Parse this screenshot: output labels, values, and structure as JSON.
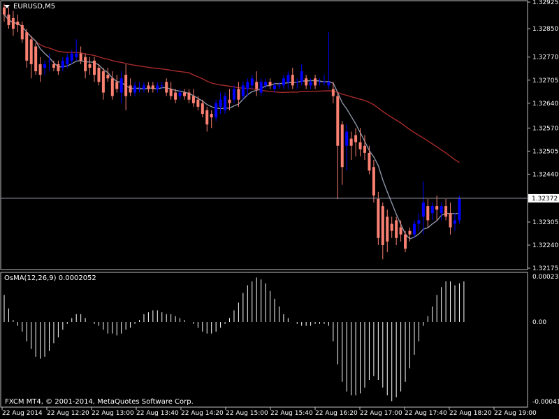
{
  "header": {
    "symbol_label": "EURUSD,M5",
    "indicator_label": "OsMA(12,26,9) 0.0002052",
    "copyright": "FXCM MT4, © 2001-2014, MetaQuotes Software Corp."
  },
  "colors": {
    "background": "#000000",
    "frame": "#c0c0c0",
    "bull": "#0000ff",
    "bear": "#fa8072",
    "ma_fast": "#8c95a6",
    "ma_slow": "#a52a2a",
    "price_line": "#a0a0b4",
    "text": "#ffffff"
  },
  "chart_data": [
    {
      "type": "candlestick",
      "symbol": "EURUSD",
      "timeframe": "M5",
      "ylim": [
        1.32175,
        1.32925
      ],
      "y_ticks": [
        "1.32925",
        "1.32850",
        "1.32770",
        "1.32705",
        "1.32640",
        "1.32570",
        "1.32505",
        "1.32440",
        "1.32305",
        "1.32240",
        "1.32175"
      ],
      "current_price": "1.32372",
      "x_ticks": [
        "22 Aug 2014",
        "22 Aug 12:20",
        "22 Aug 13:00",
        "22 Aug 13:40",
        "22 Aug 14:20",
        "22 Aug 15:00",
        "22 Aug 15:40",
        "22 Aug 16:20",
        "22 Aug 17:00",
        "22 Aug 17:40",
        "22 Aug 18:20",
        "22 Aug 19:00"
      ],
      "candles": [
        [
          1.3291,
          1.3292,
          1.3287,
          1.3289
        ],
        [
          1.3289,
          1.3291,
          1.3285,
          1.3286
        ],
        [
          1.3288,
          1.329,
          1.3283,
          1.3285
        ],
        [
          1.3287,
          1.3289,
          1.3284,
          1.3286
        ],
        [
          1.3286,
          1.3287,
          1.3281,
          1.3282
        ],
        [
          1.3284,
          1.3285,
          1.3274,
          1.3276
        ],
        [
          1.3282,
          1.3283,
          1.3271,
          1.3275
        ],
        [
          1.328,
          1.3281,
          1.3272,
          1.3273
        ],
        [
          1.3275,
          1.3277,
          1.327,
          1.3272
        ],
        [
          1.3274,
          1.3276,
          1.3272,
          1.3275
        ],
        [
          1.3276,
          1.3278,
          1.3273,
          1.3276
        ],
        [
          1.3275,
          1.3276,
          1.3273,
          1.3274
        ],
        [
          1.3275,
          1.3276,
          1.3272,
          1.3273
        ],
        [
          1.3274,
          1.3277,
          1.3273,
          1.3276
        ],
        [
          1.3275,
          1.3278,
          1.3274,
          1.3277
        ],
        [
          1.3276,
          1.3279,
          1.3275,
          1.3278
        ],
        [
          1.3277,
          1.3282,
          1.3276,
          1.3278
        ],
        [
          1.3278,
          1.328,
          1.3275,
          1.3276
        ],
        [
          1.3277,
          1.3278,
          1.3271,
          1.3273
        ],
        [
          1.3275,
          1.3277,
          1.3272,
          1.3274
        ],
        [
          1.3276,
          1.3277,
          1.327,
          1.3272
        ],
        [
          1.3274,
          1.3275,
          1.3269,
          1.327
        ],
        [
          1.3273,
          1.3274,
          1.3265,
          1.3267
        ],
        [
          1.3272,
          1.3274,
          1.327,
          1.3271
        ],
        [
          1.3271,
          1.3273,
          1.3265,
          1.3266
        ],
        [
          1.327,
          1.3272,
          1.3267,
          1.3268
        ],
        [
          1.3267,
          1.3273,
          1.3264,
          1.3271
        ],
        [
          1.3272,
          1.3275,
          1.3262,
          1.3266
        ],
        [
          1.3269,
          1.3271,
          1.3266,
          1.3267
        ],
        [
          1.3267,
          1.327,
          1.3266,
          1.3269
        ],
        [
          1.3268,
          1.327,
          1.3267,
          1.3268
        ],
        [
          1.3268,
          1.327,
          1.3267,
          1.3269
        ],
        [
          1.3269,
          1.327,
          1.3267,
          1.3268
        ],
        [
          1.3269,
          1.327,
          1.3267,
          1.3268
        ],
        [
          1.3268,
          1.327,
          1.3267,
          1.3269
        ],
        [
          1.3269,
          1.327,
          1.3268,
          1.3269
        ],
        [
          1.327,
          1.3271,
          1.3266,
          1.3267
        ],
        [
          1.3268,
          1.327,
          1.3265,
          1.3266
        ],
        [
          1.3267,
          1.3268,
          1.3264,
          1.3265
        ],
        [
          1.3266,
          1.3268,
          1.3265,
          1.3267
        ],
        [
          1.3267,
          1.3268,
          1.3265,
          1.3266
        ],
        [
          1.3267,
          1.3268,
          1.3264,
          1.3265
        ],
        [
          1.3266,
          1.3268,
          1.3263,
          1.3264
        ],
        [
          1.3265,
          1.3266,
          1.3262,
          1.3263
        ],
        [
          1.3264,
          1.3265,
          1.326,
          1.3261
        ],
        [
          1.3262,
          1.3263,
          1.3256,
          1.3258
        ],
        [
          1.3261,
          1.3262,
          1.3257,
          1.326
        ],
        [
          1.326,
          1.3265,
          1.3259,
          1.3264
        ],
        [
          1.3263,
          1.3267,
          1.3261,
          1.3265
        ],
        [
          1.3262,
          1.3267,
          1.3261,
          1.3266
        ],
        [
          1.3265,
          1.3268,
          1.3262,
          1.3264
        ],
        [
          1.3265,
          1.3269,
          1.3264,
          1.3268
        ],
        [
          1.3268,
          1.327,
          1.3263,
          1.3265
        ],
        [
          1.3266,
          1.327,
          1.3265,
          1.3269
        ],
        [
          1.3268,
          1.3271,
          1.3266,
          1.327
        ],
        [
          1.3269,
          1.3272,
          1.3268,
          1.3271
        ],
        [
          1.327,
          1.3273,
          1.3266,
          1.3268
        ],
        [
          1.3267,
          1.3271,
          1.3266,
          1.327
        ],
        [
          1.3269,
          1.3271,
          1.3268,
          1.327
        ],
        [
          1.327,
          1.3271,
          1.3268,
          1.3269
        ],
        [
          1.3268,
          1.327,
          1.3267,
          1.3269
        ],
        [
          1.3269,
          1.327,
          1.3268,
          1.3269
        ],
        [
          1.3269,
          1.3272,
          1.3268,
          1.3271
        ],
        [
          1.327,
          1.3273,
          1.3268,
          1.3272
        ],
        [
          1.3272,
          1.3274,
          1.3268,
          1.3269
        ],
        [
          1.327,
          1.3271,
          1.3268,
          1.327
        ],
        [
          1.327,
          1.3275,
          1.3269,
          1.3273
        ],
        [
          1.3271,
          1.3272,
          1.3268,
          1.3269
        ],
        [
          1.3269,
          1.3271,
          1.3268,
          1.327
        ],
        [
          1.3271,
          1.3272,
          1.3268,
          1.3269
        ],
        [
          1.327,
          1.3271,
          1.3269,
          1.327
        ],
        [
          1.327,
          1.3272,
          1.3269,
          1.327
        ],
        [
          1.3269,
          1.3284,
          1.3268,
          1.327
        ],
        [
          1.3268,
          1.327,
          1.3264,
          1.3266
        ],
        [
          1.3266,
          1.3267,
          1.3237,
          1.3252
        ],
        [
          1.3258,
          1.3259,
          1.3241,
          1.3246
        ],
        [
          1.3252,
          1.3258,
          1.3245,
          1.3256
        ],
        [
          1.3254,
          1.3256,
          1.3248,
          1.3252
        ],
        [
          1.3255,
          1.3257,
          1.3249,
          1.3253
        ],
        [
          1.3253,
          1.3257,
          1.3249,
          1.3251
        ],
        [
          1.3252,
          1.3255,
          1.3248,
          1.325
        ],
        [
          1.325,
          1.3252,
          1.3244,
          1.3245
        ],
        [
          1.3246,
          1.3248,
          1.3236,
          1.3238
        ],
        [
          1.3237,
          1.3239,
          1.3224,
          1.3226
        ],
        [
          1.3235,
          1.3236,
          1.322,
          1.3224
        ],
        [
          1.3232,
          1.3234,
          1.3222,
          1.3225
        ],
        [
          1.323,
          1.3232,
          1.3226,
          1.3228
        ],
        [
          1.3231,
          1.3232,
          1.3224,
          1.3226
        ],
        [
          1.3229,
          1.3231,
          1.3225,
          1.3227
        ],
        [
          1.3227,
          1.3228,
          1.3222,
          1.3223
        ],
        [
          1.3228,
          1.3229,
          1.3225,
          1.3227
        ],
        [
          1.3227,
          1.3231,
          1.3226,
          1.323
        ],
        [
          1.323,
          1.3233,
          1.3228,
          1.3231
        ],
        [
          1.3232,
          1.3242,
          1.3227,
          1.3236
        ],
        [
          1.3235,
          1.3237,
          1.3229,
          1.3231
        ],
        [
          1.3233,
          1.3236,
          1.3231,
          1.3235
        ],
        [
          1.3235,
          1.3238,
          1.3231,
          1.3234
        ],
        [
          1.3233,
          1.3236,
          1.3231,
          1.3235
        ],
        [
          1.3235,
          1.3237,
          1.3231,
          1.3232
        ],
        [
          1.3233,
          1.3236,
          1.3227,
          1.3229
        ],
        [
          1.323,
          1.3233,
          1.3228,
          1.3231
        ],
        [
          1.3231,
          1.3238,
          1.323,
          1.3237
        ]
      ]
    },
    {
      "type": "histogram",
      "name": "OsMA(12,26,9)",
      "ylim": [
        -0.000412,
        0.000235
      ],
      "y_ticks": [
        "0.000235",
        "0.00",
        "-0.000412"
      ],
      "values": [
        0.00014,
        7e-05,
        1e-05,
        -2e-05,
        -5e-05,
        -0.0001,
        -0.00014,
        -0.00018,
        -0.00019,
        -0.00018,
        -0.00015,
        -0.00011,
        -8e-05,
        -4e-05,
        -1e-05,
        2e-05,
        4e-05,
        4e-05,
        2e-05,
        0.0,
        -1e-05,
        -2e-05,
        -4e-05,
        -6e-05,
        -6e-05,
        -7e-05,
        -6e-05,
        -4e-05,
        -3e-05,
        -1e-05,
        1e-05,
        4e-05,
        5e-05,
        6e-05,
        6e-05,
        5e-05,
        4e-05,
        4e-05,
        3e-05,
        2e-05,
        1e-05,
        0.0,
        -1e-05,
        -3e-05,
        -5e-05,
        -6e-05,
        -6e-05,
        -5e-05,
        -3e-05,
        -1e-05,
        2e-05,
        6e-05,
        0.0001,
        0.00015,
        0.00019,
        0.00021,
        0.00023,
        0.00022,
        0.0002,
        0.00016,
        0.00012,
        8e-05,
        4e-05,
        2e-05,
        0.0,
        -1e-05,
        -2e-05,
        -2e-05,
        -2e-05,
        -1e-05,
        -1e-05,
        -1e-05,
        -2e-05,
        -0.0001,
        -0.00022,
        -0.00031,
        -0.00036,
        -0.00038,
        -0.00038,
        -0.00037,
        -0.00034,
        -0.0003,
        -0.00028,
        -0.0003,
        -0.00034,
        -0.00038,
        -0.00041,
        -0.00039,
        -0.00036,
        -0.00031,
        -0.00024,
        -0.00017,
        -0.0001,
        -2e-05,
        3e-05,
        8e-05,
        0.00014,
        0.00018,
        0.00021,
        0.00021,
        0.00019,
        0.0002,
        0.00021
      ]
    }
  ]
}
